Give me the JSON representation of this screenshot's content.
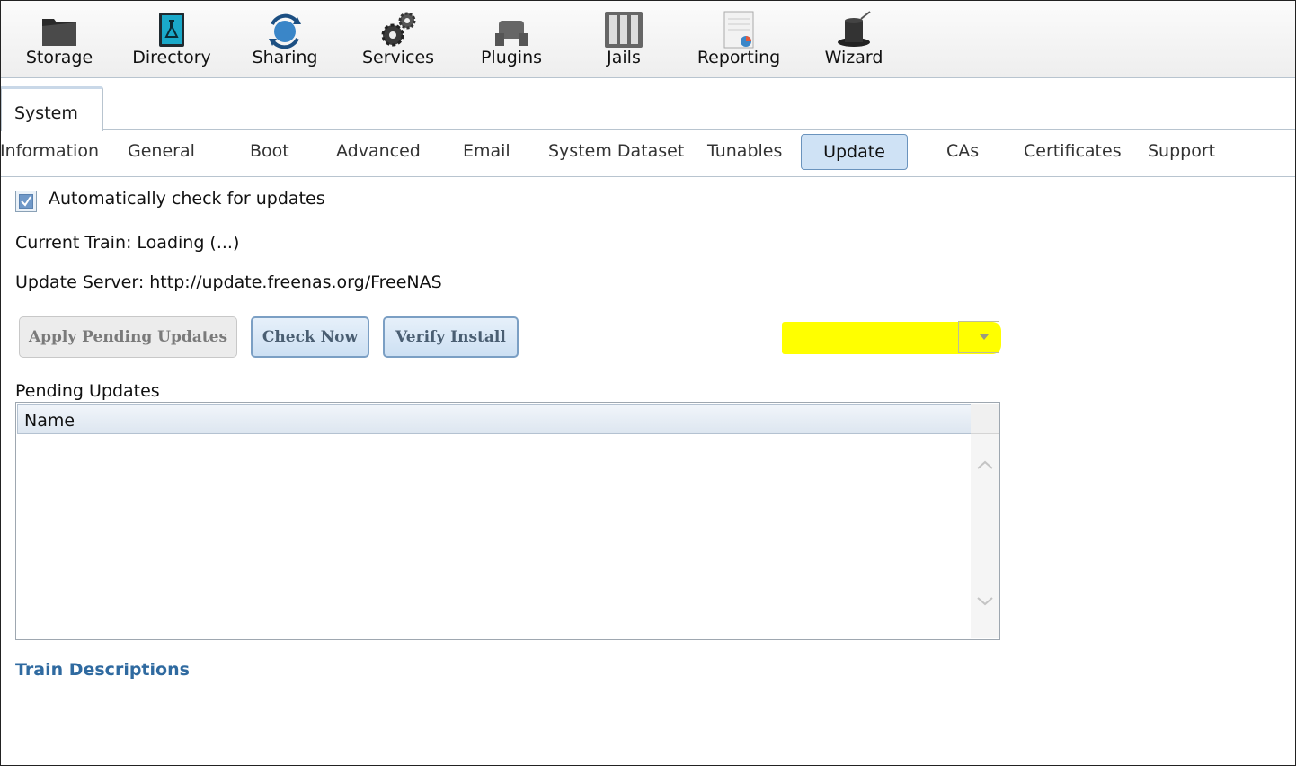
{
  "toolbar": {
    "items": [
      {
        "label": "Storage",
        "icon": "folder-icon"
      },
      {
        "label": "Directory",
        "icon": "directory-icon"
      },
      {
        "label": "Sharing",
        "icon": "sharing-icon"
      },
      {
        "label": "Services",
        "icon": "gears-icon"
      },
      {
        "label": "Plugins",
        "icon": "plugins-icon"
      },
      {
        "label": "Jails",
        "icon": "jails-icon"
      },
      {
        "label": "Reporting",
        "icon": "reporting-icon"
      },
      {
        "label": "Wizard",
        "icon": "wizard-hat-icon"
      }
    ]
  },
  "main_tab": {
    "label": "System"
  },
  "subtabs": {
    "items": [
      {
        "label": "Information"
      },
      {
        "label": "General"
      },
      {
        "label": "Boot"
      },
      {
        "label": "Advanced"
      },
      {
        "label": "Email"
      },
      {
        "label": "System Dataset"
      },
      {
        "label": "Tunables"
      },
      {
        "label": "Update",
        "active": true
      },
      {
        "label": "CAs"
      },
      {
        "label": "Certificates"
      },
      {
        "label": "Support"
      }
    ]
  },
  "update": {
    "auto_check_label": "Automatically check for updates",
    "auto_check_checked": true,
    "current_train": "Current Train: Loading (...)",
    "update_server": "Update Server: http://update.freenas.org/FreeNAS",
    "buttons": {
      "apply": "Apply Pending Updates",
      "check": "Check Now",
      "verify": "Verify Install"
    },
    "pending_label": "Pending Updates",
    "grid_header": "Name",
    "train_link": "Train Descriptions"
  },
  "colors": {
    "highlight": "#ffff00",
    "link": "#2f6aa0",
    "active_tab_bg": "#cfe2f5"
  }
}
